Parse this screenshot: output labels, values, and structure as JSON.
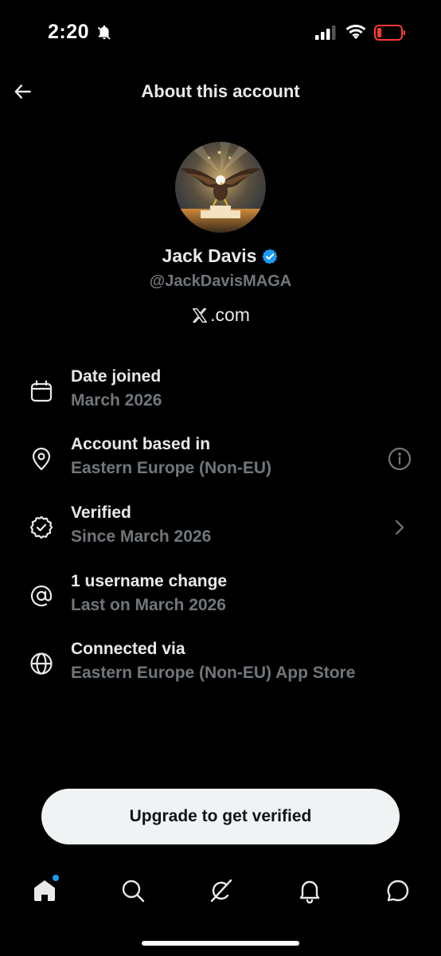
{
  "status_bar": {
    "time": "2:20",
    "icons": [
      "bell-off-icon",
      "signal-icon",
      "wifi-icon",
      "battery-icon"
    ]
  },
  "header": {
    "title": "About this account",
    "back_icon": "arrow-left-icon"
  },
  "profile": {
    "display_name": "Jack Davis",
    "handle": "@JackDavisMAGA",
    "verified": true,
    "badge_color": "#1d9bf0",
    "platform": ".com"
  },
  "info_items": [
    {
      "icon": "calendar-icon",
      "title": "Date joined",
      "subtitle": "March 2026"
    },
    {
      "icon": "location-pin-icon",
      "title": "Account based in",
      "subtitle": "Eastern Europe (Non-EU)",
      "action_icon": "info-circle-icon"
    },
    {
      "icon": "verified-check-icon",
      "title": "Verified",
      "subtitle": "Since March 2026",
      "action_icon": "chevron-right-icon"
    },
    {
      "icon": "at-sign-icon",
      "title": "1 username change",
      "subtitle": "Last on March 2026"
    },
    {
      "icon": "globe-icon",
      "title": "Connected via",
      "subtitle": "Eastern Europe (Non-EU) App Store"
    }
  ],
  "upgrade_button": {
    "label": "Upgrade to get verified"
  },
  "bottom_nav": {
    "items": [
      "home-icon",
      "search-icon",
      "grok-icon",
      "bell-icon",
      "messages-icon"
    ],
    "active": "home-icon"
  },
  "colors": {
    "background": "#000000",
    "primary_text": "#e7e9ea",
    "secondary_text": "#71767b",
    "accent": "#1d9bf0",
    "battery_low": "#ff3b30"
  }
}
